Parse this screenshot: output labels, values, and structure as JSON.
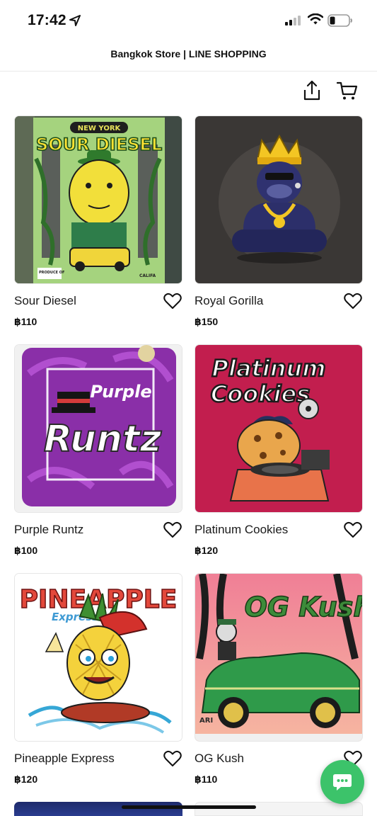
{
  "status_bar": {
    "time": "17:42"
  },
  "header": {
    "title": "Bangkok Store | LINE SHOPPING"
  },
  "products": [
    {
      "name": "Sour Diesel",
      "price": "฿110",
      "art_text": [
        "NEW YORK",
        "SOUR DIESEL",
        "PRODUCE OF",
        "CALIFA"
      ]
    },
    {
      "name": "Royal Gorilla",
      "price": "฿150",
      "art_text": []
    },
    {
      "name": "Purple Runtz",
      "price": "฿100",
      "art_text": [
        "Purple",
        "Runtz"
      ]
    },
    {
      "name": "Platinum Cookies",
      "price": "฿120",
      "art_text": [
        "Platinum",
        "Cookies"
      ]
    },
    {
      "name": "Pineapple Express",
      "price": "฿120",
      "art_text": [
        "PINEAPPLE",
        "Express"
      ]
    },
    {
      "name": "OG Kush",
      "price": "฿110",
      "art_text": [
        "OG Kush",
        "ARI"
      ]
    }
  ],
  "colors": {
    "chat_button": "#3cc36a",
    "text": "#111111"
  }
}
